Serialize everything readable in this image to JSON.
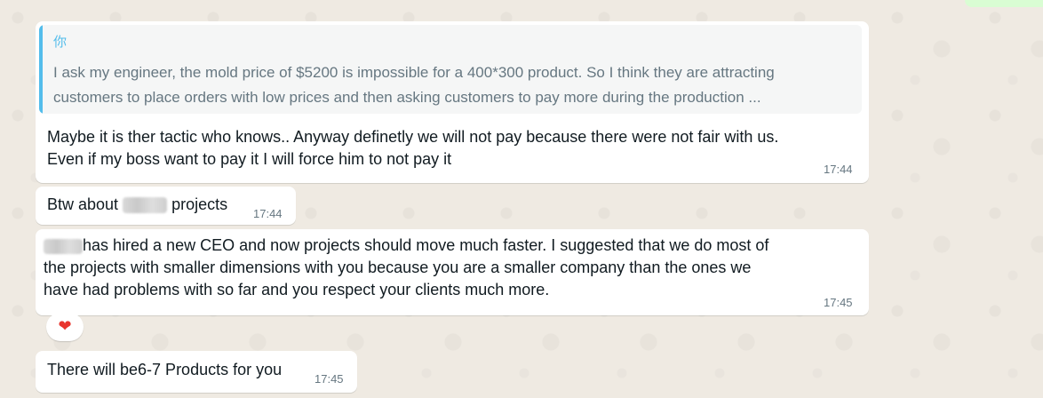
{
  "chat": {
    "messages": [
      {
        "quote": {
          "author": "你",
          "line1": "I ask my engineer, the mold price of $5200 is impossible for a 400*300 product. So I think they are attracting",
          "line2": "customers to place orders with low prices and then asking customers to pay more during the production ..."
        },
        "line1": "Maybe it is ther tactic who knows.. Anyway definetly we will not pay because there were not fair with us.",
        "line2": "Even if my boss want to pay it I will force him to not pay it",
        "time": "17:44"
      },
      {
        "before": "Btw about",
        "after": "projects",
        "time": "17:44"
      },
      {
        "line1_after": "has hired a new CEO and now projects should move much faster. I suggested that we do most of",
        "line2": "the projects with smaller dimensions with you because you are a smaller company than the ones we",
        "line3": "have had problems with so far and you respect your clients much more.",
        "time": "17:45",
        "reaction": "❤"
      },
      {
        "text": "There will be6-7 Products for you",
        "time": "17:45"
      }
    ]
  },
  "colors": {
    "background": "#efeae2",
    "bubble": "#ffffff",
    "quote_accent": "#53bdeb",
    "timestamp": "#667781",
    "outgoing_bubble": "#d9fdd3",
    "reaction_heart": "#e8352d"
  }
}
